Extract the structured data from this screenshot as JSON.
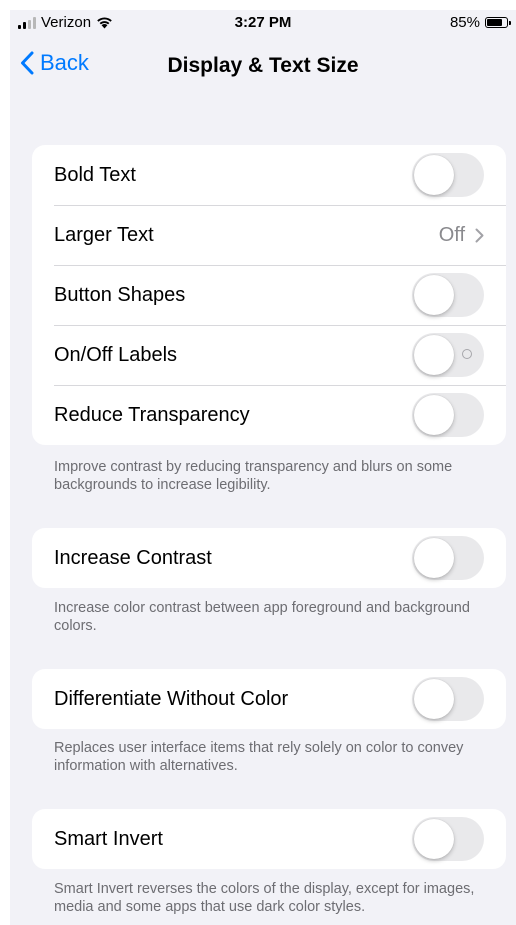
{
  "status_bar": {
    "carrier": "Verizon",
    "time": "3:27 PM",
    "battery_text": "85%",
    "battery_level": 0.85
  },
  "nav": {
    "back_label": "Back",
    "title": "Display & Text Size"
  },
  "groups": [
    {
      "rows": [
        {
          "label": "Bold Text",
          "control": "toggle",
          "on": false
        },
        {
          "label": "Larger Text",
          "control": "disclosure",
          "value": "Off"
        },
        {
          "label": "Button Shapes",
          "control": "toggle",
          "on": false
        },
        {
          "label": "On/Off Labels",
          "control": "toggle",
          "on": false,
          "shows_off_label": true
        },
        {
          "label": "Reduce Transparency",
          "control": "toggle",
          "on": false
        }
      ],
      "footer": "Improve contrast by reducing transparency and blurs on some backgrounds to increase legibility."
    },
    {
      "rows": [
        {
          "label": "Increase Contrast",
          "control": "toggle",
          "on": false
        }
      ],
      "footer": "Increase color contrast between app foreground and background colors."
    },
    {
      "rows": [
        {
          "label": "Differentiate Without Color",
          "control": "toggle",
          "on": false
        }
      ],
      "footer": "Replaces user interface items that rely solely on color to convey information with alternatives."
    },
    {
      "rows": [
        {
          "label": "Smart Invert",
          "control": "toggle",
          "on": false
        }
      ],
      "footer": "Smart Invert reverses the colors of the display, except for images, media and some apps that use dark color styles."
    }
  ],
  "colors": {
    "accent": "#007aff",
    "background": "#f2f2f7",
    "toggle_off": "#e9e9eb",
    "secondary_text": "#8a8a8e",
    "footer_text": "#6d6d72"
  },
  "icons": {
    "back": "chevron-left-icon",
    "disclosure": "chevron-right-icon",
    "signal": "cellular-signal-icon",
    "wifi": "wifi-icon",
    "battery": "battery-icon"
  }
}
